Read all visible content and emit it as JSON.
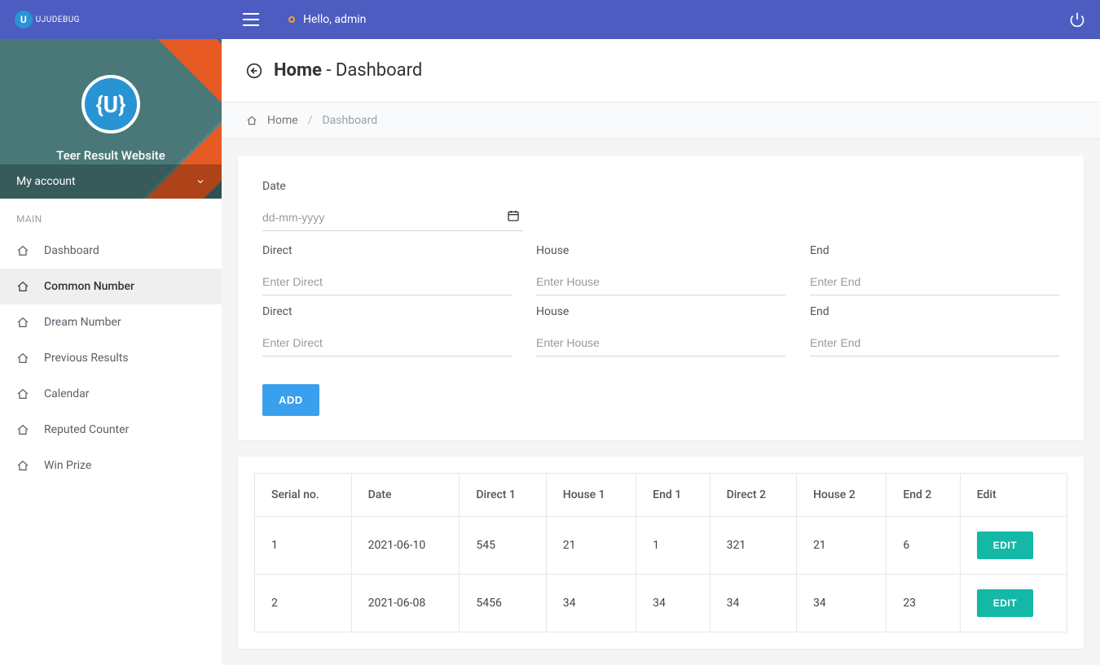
{
  "brand": {
    "short": "U",
    "text": "UJUDEBUG"
  },
  "header": {
    "greeting": "Hello, admin"
  },
  "sidebar": {
    "hero_badge": "{U}",
    "hero_title": "Teer Result Website",
    "my_account": "My account",
    "section_main": "MAIN",
    "items": [
      {
        "label": "Dashboard"
      },
      {
        "label": "Common Number"
      },
      {
        "label": "Dream Number"
      },
      {
        "label": "Previous Results"
      },
      {
        "label": "Calendar"
      },
      {
        "label": "Reputed Counter"
      },
      {
        "label": "Win Prize"
      }
    ]
  },
  "page": {
    "title_bold": "Home",
    "title_rest": " - Dashboard",
    "crumb_home": "Home",
    "crumb_sep": "/",
    "crumb_active": "Dashboard"
  },
  "form": {
    "date_label": "Date",
    "date_placeholder": "dd-mm-yyyy",
    "direct_label": "Direct",
    "direct_placeholder": "Enter Direct",
    "house_label": "House",
    "house_placeholder": "Enter House",
    "end_label": "End",
    "end_placeholder": "Enter End",
    "add_label": "ADD"
  },
  "table": {
    "headers": [
      "Serial no.",
      "Date",
      "Direct 1",
      "House 1",
      "End 1",
      "Direct 2",
      "House 2",
      "End 2",
      "Edit"
    ],
    "edit_label": "EDIT",
    "rows": [
      {
        "serial": "1",
        "date": "2021-06-10",
        "d1": "545",
        "h1": "21",
        "e1": "1",
        "d2": "321",
        "h2": "21",
        "e2": "6"
      },
      {
        "serial": "2",
        "date": "2021-06-08",
        "d1": "5456",
        "h1": "34",
        "e1": "34",
        "d2": "34",
        "h2": "34",
        "e2": "23"
      }
    ]
  }
}
